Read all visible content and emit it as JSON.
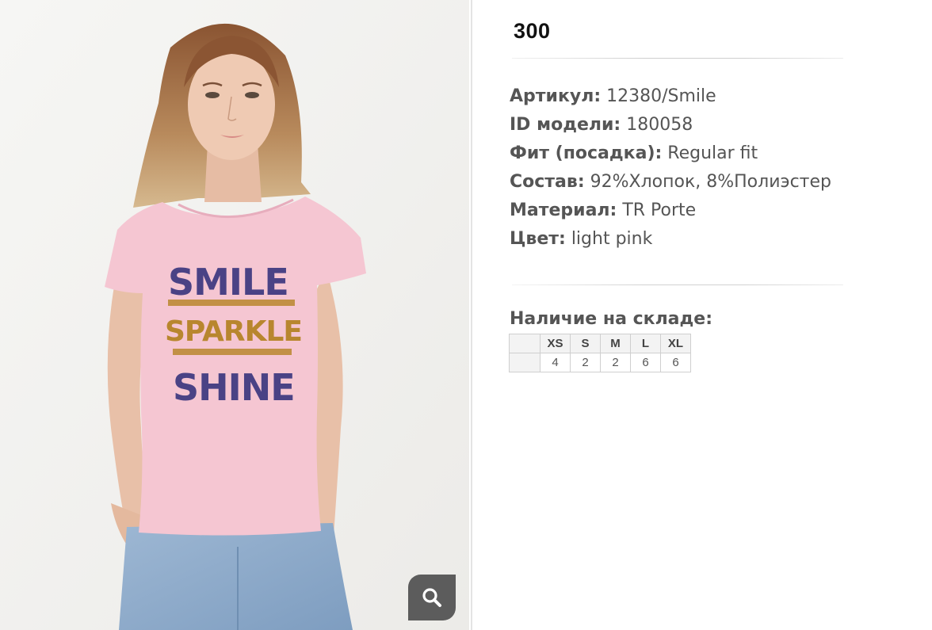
{
  "product_image": {
    "shirt_text": [
      "SMILE",
      "SPARKLE",
      "SHINE"
    ],
    "alt": "Woman wearing light pink t-shirt"
  },
  "zoom_icon": "search-icon",
  "price": "300",
  "specs": [
    {
      "key": "Артикул:",
      "value": "12380/Smile"
    },
    {
      "key": "ID модели:",
      "value": "180058"
    },
    {
      "key": "Фит (посадка):",
      "value": "Regular fit"
    },
    {
      "key": "Состав:",
      "value": "92%Хлопок, 8%Полиэстер"
    },
    {
      "key": "Материал:",
      "value": "TR Porte"
    },
    {
      "key": "Цвет:",
      "value": "light pink"
    }
  ],
  "stock": {
    "title": "Наличие на складе:",
    "sizes": [
      "XS",
      "S",
      "M",
      "L",
      "XL"
    ],
    "quantities": [
      "4",
      "2",
      "2",
      "6",
      "6"
    ]
  },
  "colors": {
    "shirt": "#f5c6d2",
    "print_purple": "#4a4285",
    "print_gold": "#b8862e"
  }
}
